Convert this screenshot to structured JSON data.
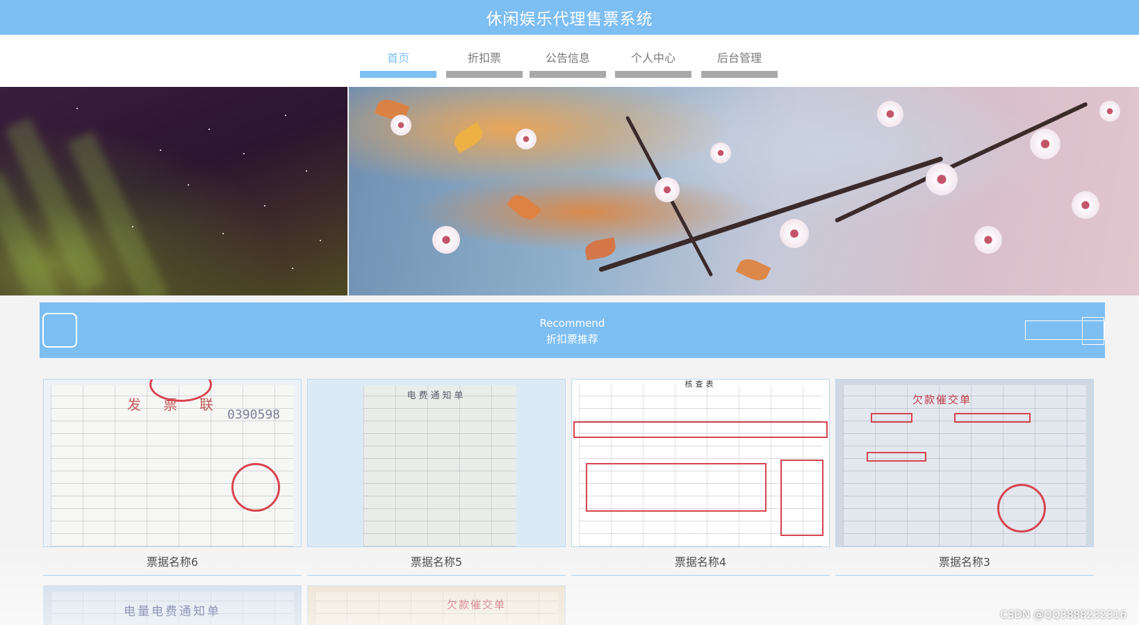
{
  "header": {
    "title": "休闲娱乐代理售票系统"
  },
  "nav": {
    "items": [
      {
        "label": "首页",
        "active": true
      },
      {
        "label": "折扣票",
        "active": false
      },
      {
        "label": "公告信息",
        "active": false
      },
      {
        "label": "个人中心",
        "active": false
      },
      {
        "label": "后台管理",
        "active": false
      }
    ]
  },
  "recommend": {
    "title_en": "Recommend",
    "title_cn": "折扣票推荐"
  },
  "cards": [
    {
      "name": "票据名称6",
      "doc": "发　票　联",
      "number": "0390598"
    },
    {
      "name": "票据名称5",
      "doc": "电费通知单"
    },
    {
      "name": "票据名称4",
      "doc": "核查表"
    },
    {
      "name": "票据名称3",
      "doc": "欠款催交单"
    }
  ],
  "partial_cards": [
    {
      "doc": "电量电费通知单"
    },
    {
      "doc": "欠款催交单"
    }
  ],
  "watermark": "CSDN @QQ3888232316",
  "colors": {
    "accent": "#7dbef3",
    "nav_inactive": "#a9a9a9",
    "stamp_red": "#d8434f"
  }
}
